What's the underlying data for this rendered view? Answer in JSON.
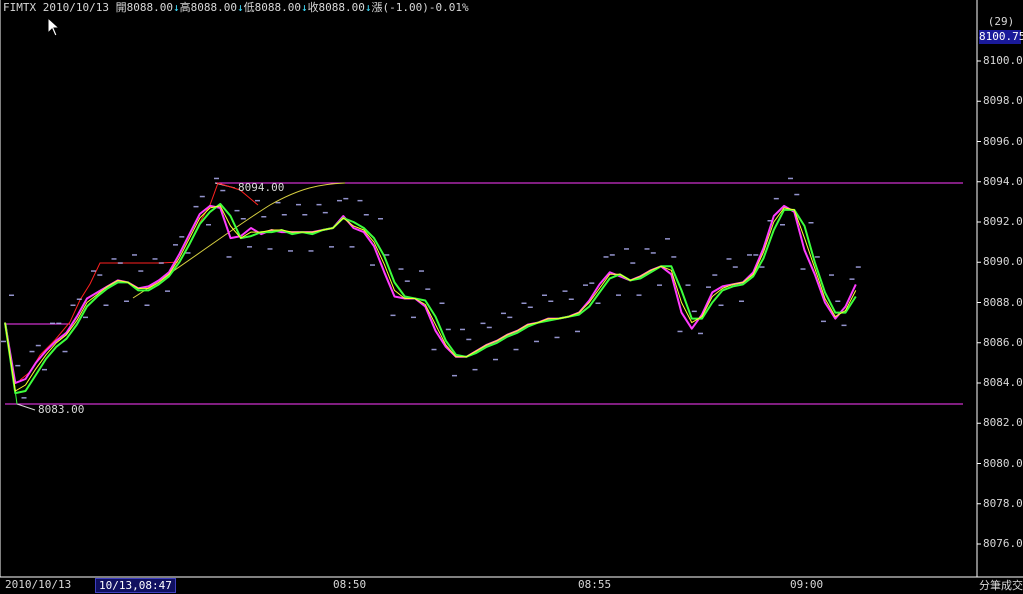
{
  "header": {
    "symbol": "FIMTX",
    "date": "2010/10/13",
    "open": "開8088.00",
    "high": "高8088.00",
    "low": "低8088.00",
    "close": "收8088.00",
    "change": "漲(-1.00)-0.01%",
    "arrow": "↓"
  },
  "right_panel": {
    "count": "(29)",
    "current_price": "8100.75",
    "mode": "分筆成交"
  },
  "bottom": {
    "date": "2010/10/13",
    "cursor_time": "10/13,08:47"
  },
  "annotations": {
    "high_label": "8094.00",
    "low_label": "8083.00"
  },
  "colors": {
    "background": "#000000",
    "axis": "#ffffff",
    "magenta": "#ff3cff",
    "green": "#3cff3c",
    "yellow": "#ffff30",
    "red": "#ff2020",
    "cyan": "#40e0ff",
    "dot": "#c8c8ff"
  },
  "chart_data": {
    "type": "line",
    "title": "",
    "xlabel": "",
    "ylabel": "",
    "x_ticks": [
      "08:50",
      "08:55",
      "09:00"
    ],
    "y_ticks": [
      8076,
      8078,
      8080,
      8082,
      8084,
      8086,
      8088,
      8090,
      8092,
      8094,
      8096,
      8098,
      8100
    ],
    "ylim": [
      8074.25,
      8101.8
    ],
    "x_minutes": [
      0,
      0.25,
      0.5,
      0.75,
      1,
      1.25,
      1.5,
      1.75,
      2,
      2.25,
      2.5,
      2.75,
      3,
      3.25,
      3.5,
      3.75,
      4,
      4.25,
      4.5,
      4.75,
      5,
      5.25,
      5.5,
      5.75,
      6,
      6.25,
      6.5,
      6.75,
      7,
      7.25,
      7.5,
      7.75,
      8,
      8.25,
      8.5,
      8.75,
      9,
      9.25,
      9.5,
      9.75,
      10,
      10.25,
      10.5,
      10.75,
      11,
      11.25,
      11.5,
      11.75,
      12,
      12.25,
      12.5,
      12.75,
      13,
      13.25,
      13.5,
      13.75,
      14,
      14.25,
      14.5,
      14.75,
      15,
      15.25,
      15.5,
      15.75,
      16,
      16.25,
      16.5,
      16.75,
      17,
      17.25,
      17.5,
      17.75,
      18,
      18.25,
      18.5,
      18.75,
      19,
      19.25,
      19.5,
      19.75,
      20,
      20.25,
      20.5,
      20.75,
      21,
      21.25,
      21.5,
      21.75,
      22,
      22.25,
      22.5,
      22.75,
      23,
      23.25,
      23.5,
      23.75
    ],
    "series": [
      {
        "color": "#ff3cff",
        "values": [
          8087,
          8084,
          8084.2,
          8085,
          8085.6,
          8086.1,
          8086.5,
          8087.3,
          8088.2,
          8088.5,
          8088.8,
          8089.1,
          8089,
          8088.7,
          8088.8,
          8089.1,
          8089.5,
          8090.4,
          8091.4,
          8092.4,
          8092.8,
          8092.7,
          8091.2,
          8091.3,
          8091.7,
          8091.4,
          8091.6,
          8091.5,
          8091.5,
          8091.5,
          8091.5,
          8091.6,
          8091.7,
          8092.3,
          8091.7,
          8091.5,
          8090.8,
          8089.5,
          8088.3,
          8088.2,
          8088.2,
          8087.8,
          8086.6,
          8085.8,
          8085.3,
          8085.3,
          8085.6,
          8085.9,
          8086.1,
          8086.4,
          8086.6,
          8086.9,
          8087,
          8087.2,
          8087.2,
          8087.3,
          8087.5,
          8088.1,
          8088.9,
          8089.5,
          8089.3,
          8089.1,
          8089.3,
          8089.6,
          8089.8,
          8089.4,
          8087.5,
          8086.7,
          8087.4,
          8088.5,
          8088.8,
          8088.9,
          8089,
          8089.5,
          8090.7,
          8092.3,
          8092.8,
          8092.5,
          8090.6,
          8089.4,
          8088,
          8087.2,
          8087.8,
          8088.9
        ]
      },
      {
        "color": "#3cff3c",
        "values": [
          8087,
          8083.5,
          8083.6,
          8084.4,
          8085.2,
          8085.8,
          8086.2,
          8086.9,
          8087.8,
          8088.3,
          8088.7,
          8089,
          8089,
          8088.6,
          8088.6,
          8088.9,
          8089.3,
          8090,
          8090.9,
          8091.9,
          8092.5,
          8092.9,
          8092.3,
          8091.2,
          8091.3,
          8091.5,
          8091.5,
          8091.6,
          8091.4,
          8091.5,
          8091.4,
          8091.6,
          8091.7,
          8092.2,
          8092,
          8091.7,
          8091.2,
          8090.3,
          8089,
          8088.3,
          8088.2,
          8088.1,
          8087.3,
          8086.1,
          8085.4,
          8085.3,
          8085.5,
          8085.8,
          8086,
          8086.3,
          8086.5,
          8086.8,
          8087,
          8087.1,
          8087.2,
          8087.3,
          8087.4,
          8087.8,
          8088.5,
          8089.2,
          8089.4,
          8089.1,
          8089.2,
          8089.5,
          8089.8,
          8089.8,
          8088.6,
          8087.2,
          8087.2,
          8088,
          8088.6,
          8088.8,
          8088.9,
          8089.3,
          8090.2,
          8091.6,
          8092.6,
          8092.6,
          8091.8,
          8090,
          8088.5,
          8087.5,
          8087.5,
          8088.3
        ]
      },
      {
        "color": "#ffff30",
        "values": [
          8087,
          8083.6,
          8083.9,
          8084.7,
          8085.4,
          8086,
          8086.4,
          8087.1,
          8088,
          8088.4,
          8088.8,
          8089.1,
          8089,
          8088.7,
          8088.7,
          8089,
          8089.4,
          8090.2,
          8091.2,
          8092.2,
          8092.7,
          8092.8,
          8091.8,
          8091.2,
          8091.5,
          8091.5,
          8091.6,
          8091.6,
          8091.5,
          8091.5,
          8091.5,
          8091.6,
          8091.7,
          8092.2,
          8091.8,
          8091.6,
          8091,
          8089.9,
          8088.6,
          8088.2,
          8088.2,
          8087.9,
          8086.9,
          8085.9,
          8085.3,
          8085.3,
          8085.6,
          8085.9,
          8086.1,
          8086.4,
          8086.6,
          8086.9,
          8087,
          8087.2,
          8087.2,
          8087.3,
          8087.5,
          8088,
          8088.7,
          8089.4,
          8089.4,
          8089.1,
          8089.3,
          8089.6,
          8089.8,
          8089.6,
          8088,
          8087,
          8087.3,
          8088.3,
          8088.7,
          8088.9,
          8089,
          8089.4,
          8090.5,
          8092,
          8092.7,
          8092.6,
          8091.2,
          8089.7,
          8088.2,
          8087.3,
          8087.6,
          8088.6
        ]
      }
    ]
  }
}
